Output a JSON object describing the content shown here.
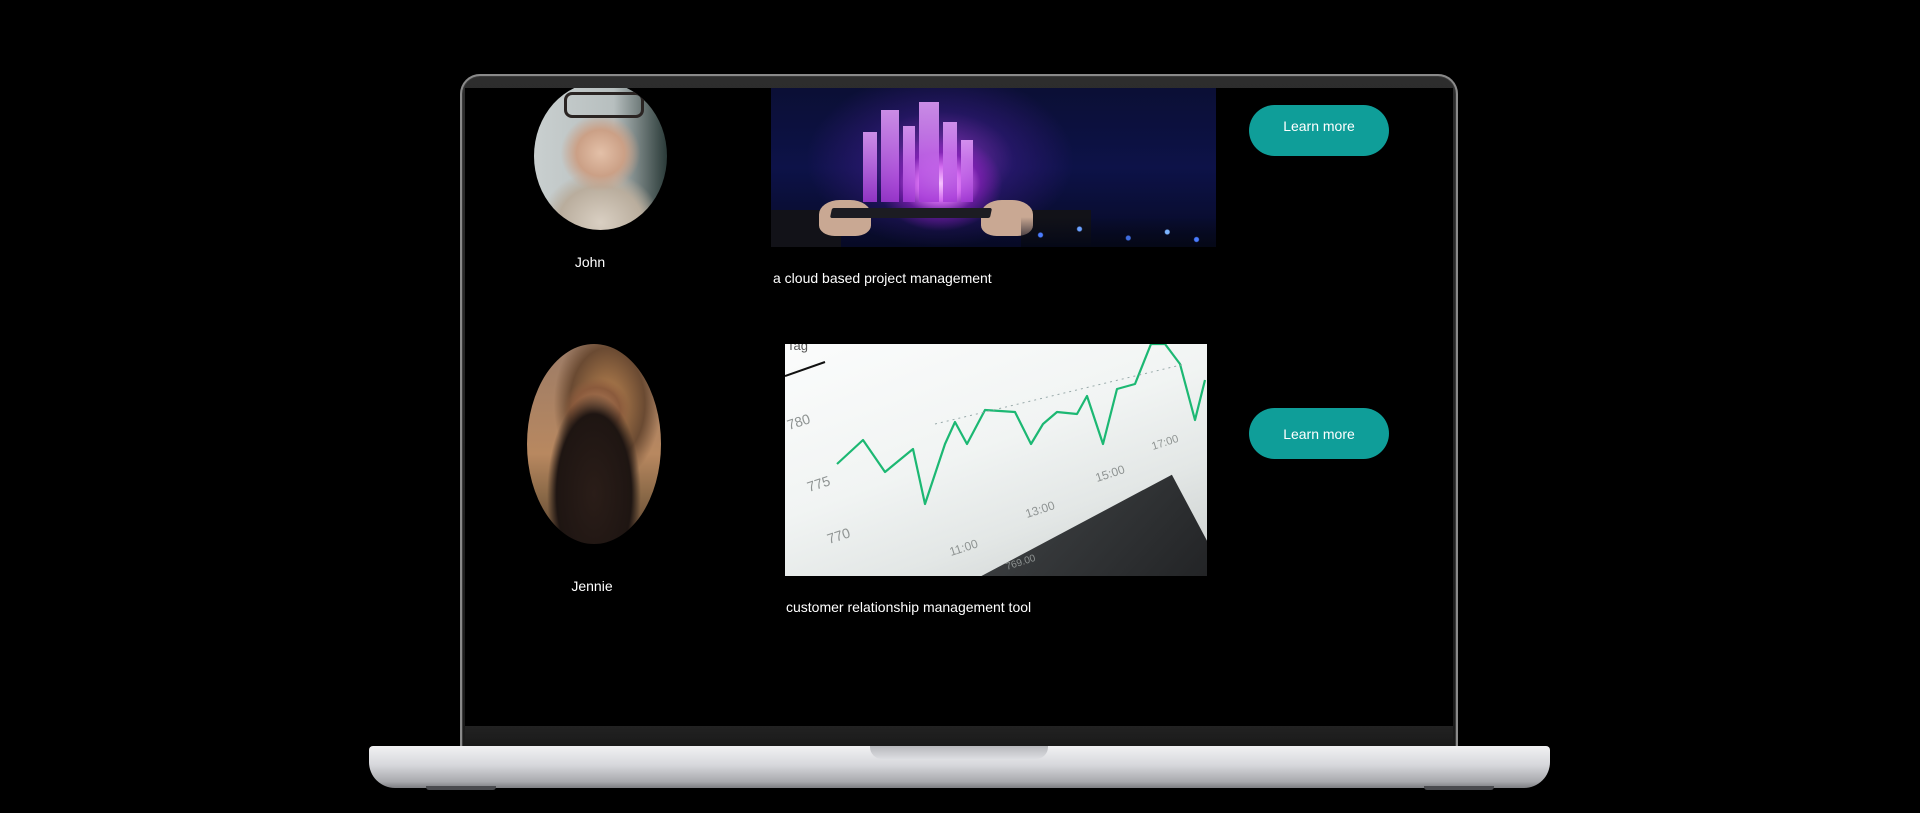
{
  "cards": [
    {
      "person_name": "John",
      "description": "a cloud based project management",
      "button_label": "Learn more"
    },
    {
      "person_name": "Jennie",
      "description": "customer relationship management tool",
      "button_label": "Learn more"
    }
  ],
  "chart_photo": {
    "tick_labels_y": [
      "780",
      "775",
      "770"
    ],
    "tick_labels_x": [
      "11:00",
      "13:00",
      "15:00",
      "17:00"
    ],
    "misc_labels": [
      "Tag",
      "769.00"
    ]
  },
  "colors": {
    "background": "#000000",
    "button": "#0f9e99",
    "text": "#ffffff",
    "chart_line": "#1cb873"
  }
}
